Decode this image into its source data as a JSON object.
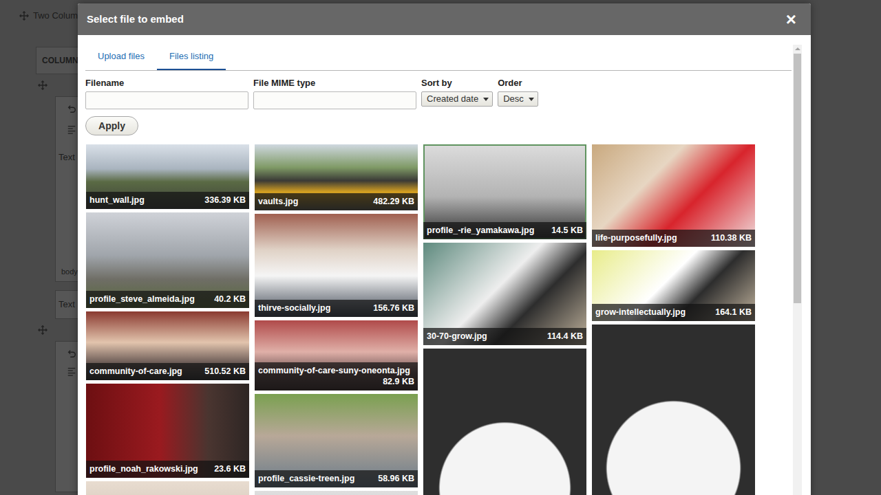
{
  "page": {
    "heading": "Two Colum",
    "column_label": "COLUMN",
    "fields": [
      "Text",
      "body",
      "Text"
    ]
  },
  "dialog": {
    "title": "Select file to embed",
    "close": "×"
  },
  "tabs": [
    {
      "label": "Upload files",
      "selected": false
    },
    {
      "label": "Files listing",
      "selected": true
    }
  ],
  "filters": {
    "filename": {
      "label": "Filename",
      "value": ""
    },
    "mime": {
      "label": "File MIME type",
      "value": ""
    },
    "sort_by": {
      "label": "Sort by",
      "value": "Created date"
    },
    "order": {
      "label": "Order",
      "value": "Desc"
    },
    "apply": "Apply"
  },
  "scrollbar": {
    "level": 0.54
  },
  "columns": [
    [
      {
        "name": "hunt_wall.jpg",
        "size": "336.39 KB",
        "selected": false
      },
      {
        "name": "profile_steve_almeida.jpg",
        "size": "40.2 KB",
        "selected": false
      },
      {
        "name": "community-of-care.jpg",
        "size": "510.52 KB",
        "selected": false
      },
      {
        "name": "profile_noah_rakowski.jpg",
        "size": "23.6 KB",
        "selected": false
      },
      {
        "selected": false
      }
    ],
    [
      {
        "name": "vaults.jpg",
        "size": "482.29 KB",
        "selected": false
      },
      {
        "name": "thirve-socially.jpg",
        "size": "156.76 KB",
        "selected": false
      },
      {
        "name": "community-of-care-suny-oneonta.jpg",
        "size": "82.9 KB",
        "selected": false
      },
      {
        "name": "profile_cassie-treen.jpg",
        "size": "58.96 KB",
        "selected": false
      },
      {
        "selected": false
      }
    ],
    [
      {
        "name": "profile_-rie_yamakawa.jpg",
        "size": "14.5 KB",
        "selected": true
      },
      {
        "name": "30-70-grow.jpg",
        "size": "114.4 KB",
        "selected": false
      },
      {
        "selected": false
      }
    ],
    [
      {
        "name": "life-purposefully.jpg",
        "size": "110.38 KB",
        "selected": false
      },
      {
        "name": "grow-intellectually.jpg",
        "size": "164.1 KB",
        "selected": false
      },
      {
        "selected": false
      }
    ]
  ]
}
